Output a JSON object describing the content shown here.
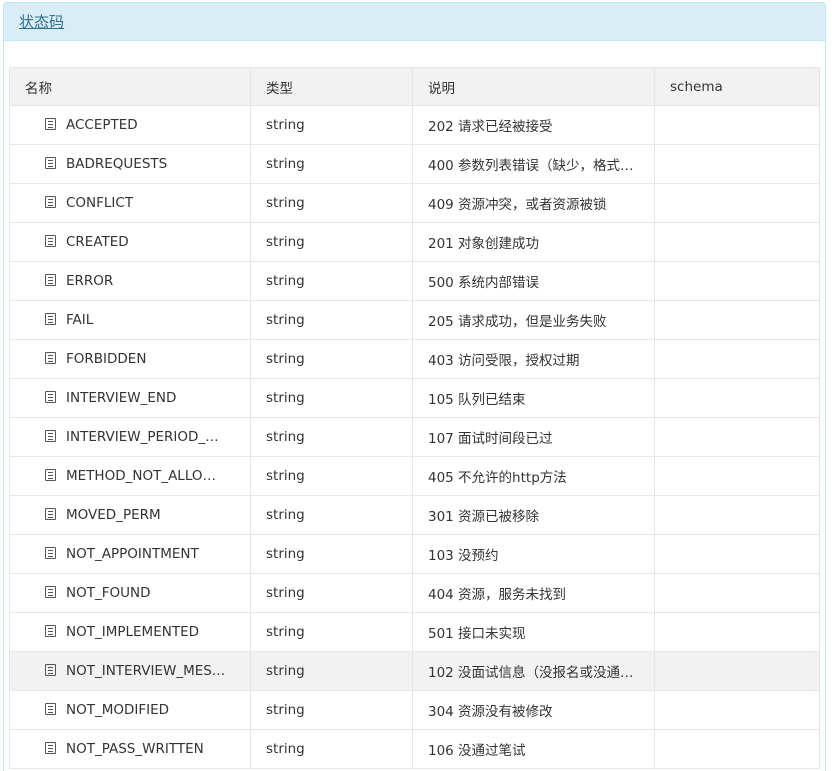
{
  "panel": {
    "title": "状态码"
  },
  "table": {
    "headers": [
      "名称",
      "类型",
      "说明",
      "schema"
    ],
    "rows": [
      {
        "name": "ACCEPTED",
        "type": "string",
        "desc": "202 请求已经被接受",
        "schema": ""
      },
      {
        "name": "BADREQUESTS",
        "type": "string",
        "desc": "400 参数列表错误（缺少，格式…",
        "schema": ""
      },
      {
        "name": "CONFLICT",
        "type": "string",
        "desc": "409 资源冲突，或者资源被锁",
        "schema": ""
      },
      {
        "name": "CREATED",
        "type": "string",
        "desc": "201 对象创建成功",
        "schema": ""
      },
      {
        "name": "ERROR",
        "type": "string",
        "desc": "500 系统内部错误",
        "schema": ""
      },
      {
        "name": "FAIL",
        "type": "string",
        "desc": "205 请求成功，但是业务失败",
        "schema": ""
      },
      {
        "name": "FORBIDDEN",
        "type": "string",
        "desc": "403 访问受限，授权过期",
        "schema": ""
      },
      {
        "name": "INTERVIEW_END",
        "type": "string",
        "desc": "105 队列已结束",
        "schema": ""
      },
      {
        "name": "INTERVIEW_PERIOD_…",
        "type": "string",
        "desc": "107 面试时间段已过",
        "schema": ""
      },
      {
        "name": "METHOD_NOT_ALLO…",
        "type": "string",
        "desc": "405 不允许的http方法",
        "schema": ""
      },
      {
        "name": "MOVED_PERM",
        "type": "string",
        "desc": "301 资源已被移除",
        "schema": ""
      },
      {
        "name": "NOT_APPOINTMENT",
        "type": "string",
        "desc": "103 没预约",
        "schema": ""
      },
      {
        "name": "NOT_FOUND",
        "type": "string",
        "desc": "404 资源，服务未找到",
        "schema": ""
      },
      {
        "name": "NOT_IMPLEMENTED",
        "type": "string",
        "desc": "501 接口未实现",
        "schema": ""
      },
      {
        "name": "NOT_INTERVIEW_MES…",
        "type": "string",
        "desc": "102 没面试信息（没报名或没通…",
        "schema": ""
      },
      {
        "name": "NOT_MODIFIED",
        "type": "string",
        "desc": "304 资源没有被修改",
        "schema": ""
      },
      {
        "name": "NOT_PASS_WRITTEN",
        "type": "string",
        "desc": "106 没通过笔试",
        "schema": ""
      }
    ],
    "highlighted_row_index": 14
  },
  "icons": {
    "row_icon": "document-list-icon"
  },
  "colors": {
    "heading_bg": "#d9edf7",
    "heading_text": "#31708f",
    "header_bg": "#f2f2f2",
    "highlight_bg": "#f2f2f2",
    "border": "#e6e6e6"
  }
}
